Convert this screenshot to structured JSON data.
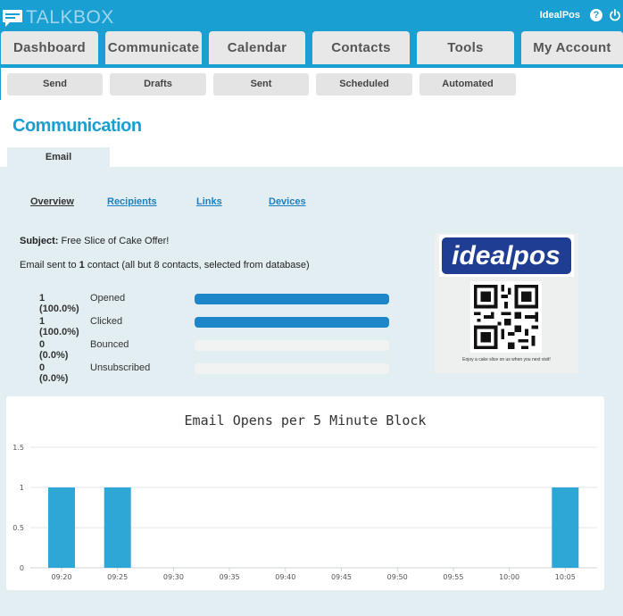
{
  "header": {
    "brand": "TALKBOX",
    "user": "IdealPos",
    "help_icon": "question-circle-icon",
    "power_icon": "power-icon"
  },
  "main_tabs": [
    "Dashboard",
    "Communicate",
    "Calendar",
    "Contacts",
    "Tools",
    "My Account"
  ],
  "sub_tabs": [
    "Send",
    "Drafts",
    "Sent",
    "Scheduled",
    "Automated"
  ],
  "page": {
    "title": "Communication",
    "tab": "Email"
  },
  "subnav": [
    "Overview",
    "Recipients",
    "Links",
    "Devices"
  ],
  "summary": {
    "subject_label": "Subject:",
    "subject": "Free Slice of Cake Offer!",
    "sent_prefix": "Email sent to",
    "sent_count": "1",
    "sent_suffix": "contact (all but 8 contacts, selected from database)"
  },
  "stats": [
    {
      "count": "1 (100.0%)",
      "label": "Opened",
      "percent": 100
    },
    {
      "count": "1 (100.0%)",
      "label": "Clicked",
      "percent": 100
    },
    {
      "count": "0 (0.0%)",
      "label": "Bounced",
      "percent": 0
    },
    {
      "count": "0 (0.0%)",
      "label": "Unsubscribed",
      "percent": 0
    }
  ],
  "ad": {
    "logo_text": "idealpos",
    "caption": "Enjoy a cake slice on us when you next visit!"
  },
  "colors": {
    "brand": "#1a9fd2",
    "bar_fill": "#1c86c8",
    "chart_bar": "#2ea7d6",
    "link": "#1a7fc0"
  },
  "chart_data": {
    "type": "bar",
    "title": "Email Opens per 5 Minute Block",
    "categories": [
      "09:20",
      "09:25",
      "09:30",
      "09:35",
      "09:40",
      "09:45",
      "09:50",
      "09:55",
      "10:00",
      "10:05"
    ],
    "values": [
      1,
      1,
      0,
      0,
      0,
      0,
      0,
      0,
      0,
      1
    ],
    "yticks": [
      "0",
      "0.5",
      "1",
      "1.5"
    ],
    "ylim": [
      0,
      1.5
    ],
    "grid": true
  }
}
